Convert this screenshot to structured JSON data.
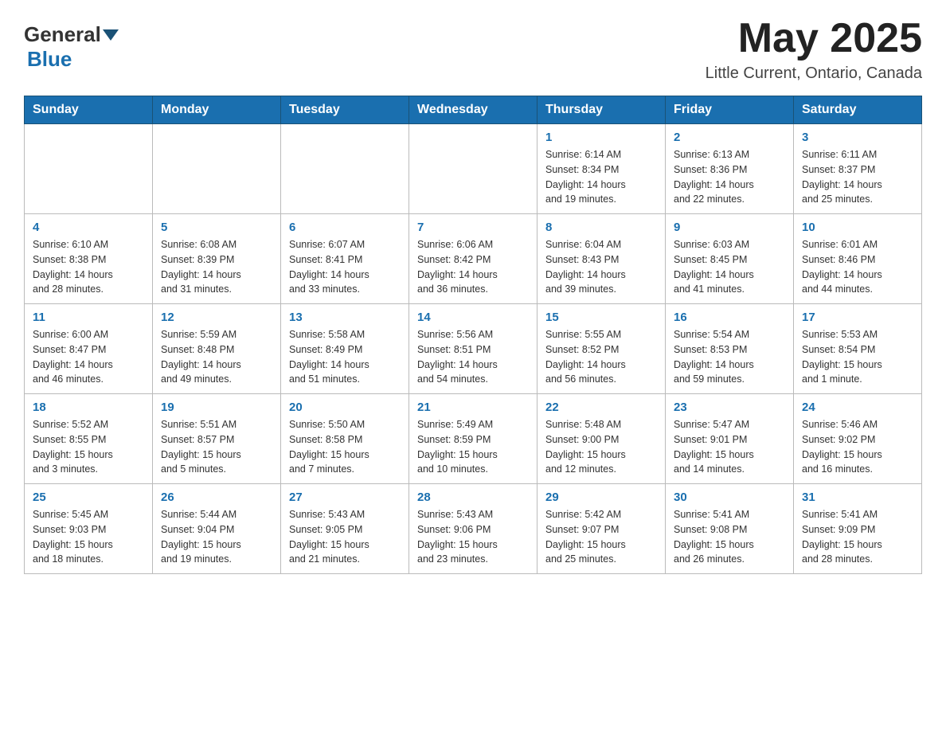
{
  "header": {
    "logo_general": "General",
    "logo_blue": "Blue",
    "month_title": "May 2025",
    "location": "Little Current, Ontario, Canada"
  },
  "days_of_week": [
    "Sunday",
    "Monday",
    "Tuesday",
    "Wednesday",
    "Thursday",
    "Friday",
    "Saturday"
  ],
  "weeks": [
    [
      {
        "day": "",
        "info": ""
      },
      {
        "day": "",
        "info": ""
      },
      {
        "day": "",
        "info": ""
      },
      {
        "day": "",
        "info": ""
      },
      {
        "day": "1",
        "info": "Sunrise: 6:14 AM\nSunset: 8:34 PM\nDaylight: 14 hours\nand 19 minutes."
      },
      {
        "day": "2",
        "info": "Sunrise: 6:13 AM\nSunset: 8:36 PM\nDaylight: 14 hours\nand 22 minutes."
      },
      {
        "day": "3",
        "info": "Sunrise: 6:11 AM\nSunset: 8:37 PM\nDaylight: 14 hours\nand 25 minutes."
      }
    ],
    [
      {
        "day": "4",
        "info": "Sunrise: 6:10 AM\nSunset: 8:38 PM\nDaylight: 14 hours\nand 28 minutes."
      },
      {
        "day": "5",
        "info": "Sunrise: 6:08 AM\nSunset: 8:39 PM\nDaylight: 14 hours\nand 31 minutes."
      },
      {
        "day": "6",
        "info": "Sunrise: 6:07 AM\nSunset: 8:41 PM\nDaylight: 14 hours\nand 33 minutes."
      },
      {
        "day": "7",
        "info": "Sunrise: 6:06 AM\nSunset: 8:42 PM\nDaylight: 14 hours\nand 36 minutes."
      },
      {
        "day": "8",
        "info": "Sunrise: 6:04 AM\nSunset: 8:43 PM\nDaylight: 14 hours\nand 39 minutes."
      },
      {
        "day": "9",
        "info": "Sunrise: 6:03 AM\nSunset: 8:45 PM\nDaylight: 14 hours\nand 41 minutes."
      },
      {
        "day": "10",
        "info": "Sunrise: 6:01 AM\nSunset: 8:46 PM\nDaylight: 14 hours\nand 44 minutes."
      }
    ],
    [
      {
        "day": "11",
        "info": "Sunrise: 6:00 AM\nSunset: 8:47 PM\nDaylight: 14 hours\nand 46 minutes."
      },
      {
        "day": "12",
        "info": "Sunrise: 5:59 AM\nSunset: 8:48 PM\nDaylight: 14 hours\nand 49 minutes."
      },
      {
        "day": "13",
        "info": "Sunrise: 5:58 AM\nSunset: 8:49 PM\nDaylight: 14 hours\nand 51 minutes."
      },
      {
        "day": "14",
        "info": "Sunrise: 5:56 AM\nSunset: 8:51 PM\nDaylight: 14 hours\nand 54 minutes."
      },
      {
        "day": "15",
        "info": "Sunrise: 5:55 AM\nSunset: 8:52 PM\nDaylight: 14 hours\nand 56 minutes."
      },
      {
        "day": "16",
        "info": "Sunrise: 5:54 AM\nSunset: 8:53 PM\nDaylight: 14 hours\nand 59 minutes."
      },
      {
        "day": "17",
        "info": "Sunrise: 5:53 AM\nSunset: 8:54 PM\nDaylight: 15 hours\nand 1 minute."
      }
    ],
    [
      {
        "day": "18",
        "info": "Sunrise: 5:52 AM\nSunset: 8:55 PM\nDaylight: 15 hours\nand 3 minutes."
      },
      {
        "day": "19",
        "info": "Sunrise: 5:51 AM\nSunset: 8:57 PM\nDaylight: 15 hours\nand 5 minutes."
      },
      {
        "day": "20",
        "info": "Sunrise: 5:50 AM\nSunset: 8:58 PM\nDaylight: 15 hours\nand 7 minutes."
      },
      {
        "day": "21",
        "info": "Sunrise: 5:49 AM\nSunset: 8:59 PM\nDaylight: 15 hours\nand 10 minutes."
      },
      {
        "day": "22",
        "info": "Sunrise: 5:48 AM\nSunset: 9:00 PM\nDaylight: 15 hours\nand 12 minutes."
      },
      {
        "day": "23",
        "info": "Sunrise: 5:47 AM\nSunset: 9:01 PM\nDaylight: 15 hours\nand 14 minutes."
      },
      {
        "day": "24",
        "info": "Sunrise: 5:46 AM\nSunset: 9:02 PM\nDaylight: 15 hours\nand 16 minutes."
      }
    ],
    [
      {
        "day": "25",
        "info": "Sunrise: 5:45 AM\nSunset: 9:03 PM\nDaylight: 15 hours\nand 18 minutes."
      },
      {
        "day": "26",
        "info": "Sunrise: 5:44 AM\nSunset: 9:04 PM\nDaylight: 15 hours\nand 19 minutes."
      },
      {
        "day": "27",
        "info": "Sunrise: 5:43 AM\nSunset: 9:05 PM\nDaylight: 15 hours\nand 21 minutes."
      },
      {
        "day": "28",
        "info": "Sunrise: 5:43 AM\nSunset: 9:06 PM\nDaylight: 15 hours\nand 23 minutes."
      },
      {
        "day": "29",
        "info": "Sunrise: 5:42 AM\nSunset: 9:07 PM\nDaylight: 15 hours\nand 25 minutes."
      },
      {
        "day": "30",
        "info": "Sunrise: 5:41 AM\nSunset: 9:08 PM\nDaylight: 15 hours\nand 26 minutes."
      },
      {
        "day": "31",
        "info": "Sunrise: 5:41 AM\nSunset: 9:09 PM\nDaylight: 15 hours\nand 28 minutes."
      }
    ]
  ]
}
